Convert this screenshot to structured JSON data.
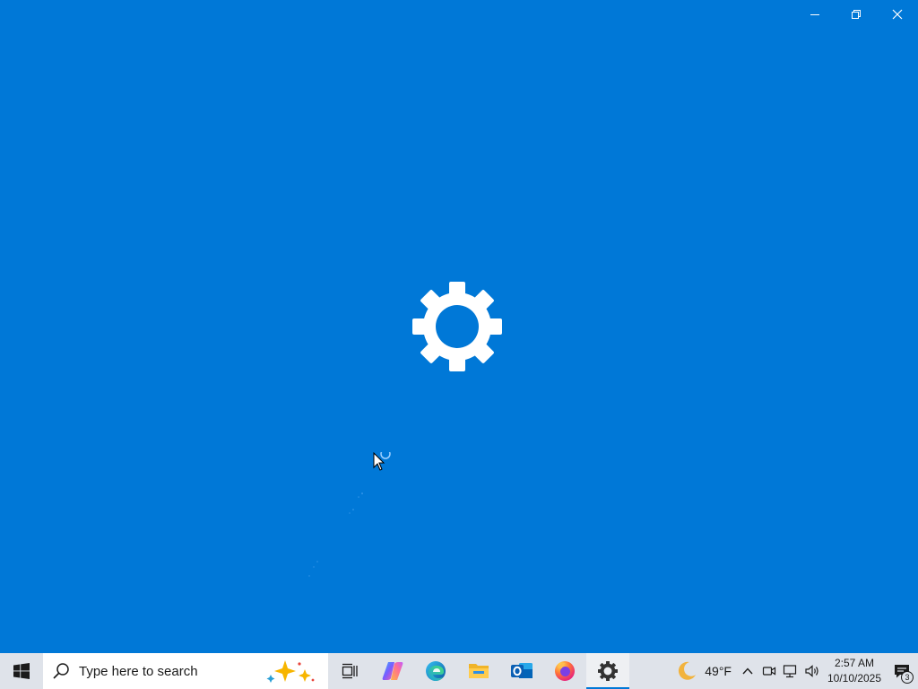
{
  "window": {
    "controls": {
      "minimize_icon": "minimize-icon",
      "restore_icon": "restore-icon",
      "close_icon": "close-icon"
    },
    "background_color": "#0078d7",
    "splash_icon": "settings-gear-icon"
  },
  "taskbar": {
    "search": {
      "placeholder": "Type here to search"
    },
    "pinned": [
      {
        "name": "task-view",
        "icon": "task-view-icon"
      },
      {
        "name": "copilot",
        "icon": "copilot-icon"
      },
      {
        "name": "edge",
        "icon": "edge-icon"
      },
      {
        "name": "file-explorer",
        "icon": "folder-icon"
      },
      {
        "name": "outlook",
        "icon": "outlook-icon"
      },
      {
        "name": "firefox",
        "icon": "firefox-icon"
      },
      {
        "name": "settings",
        "icon": "gear-icon",
        "active": true
      }
    ],
    "weather": {
      "icon": "moon-icon",
      "temperature": "49°F"
    },
    "clock": {
      "time": "2:57 AM",
      "date": "10/10/2025"
    },
    "notifications": {
      "count": "3"
    }
  }
}
